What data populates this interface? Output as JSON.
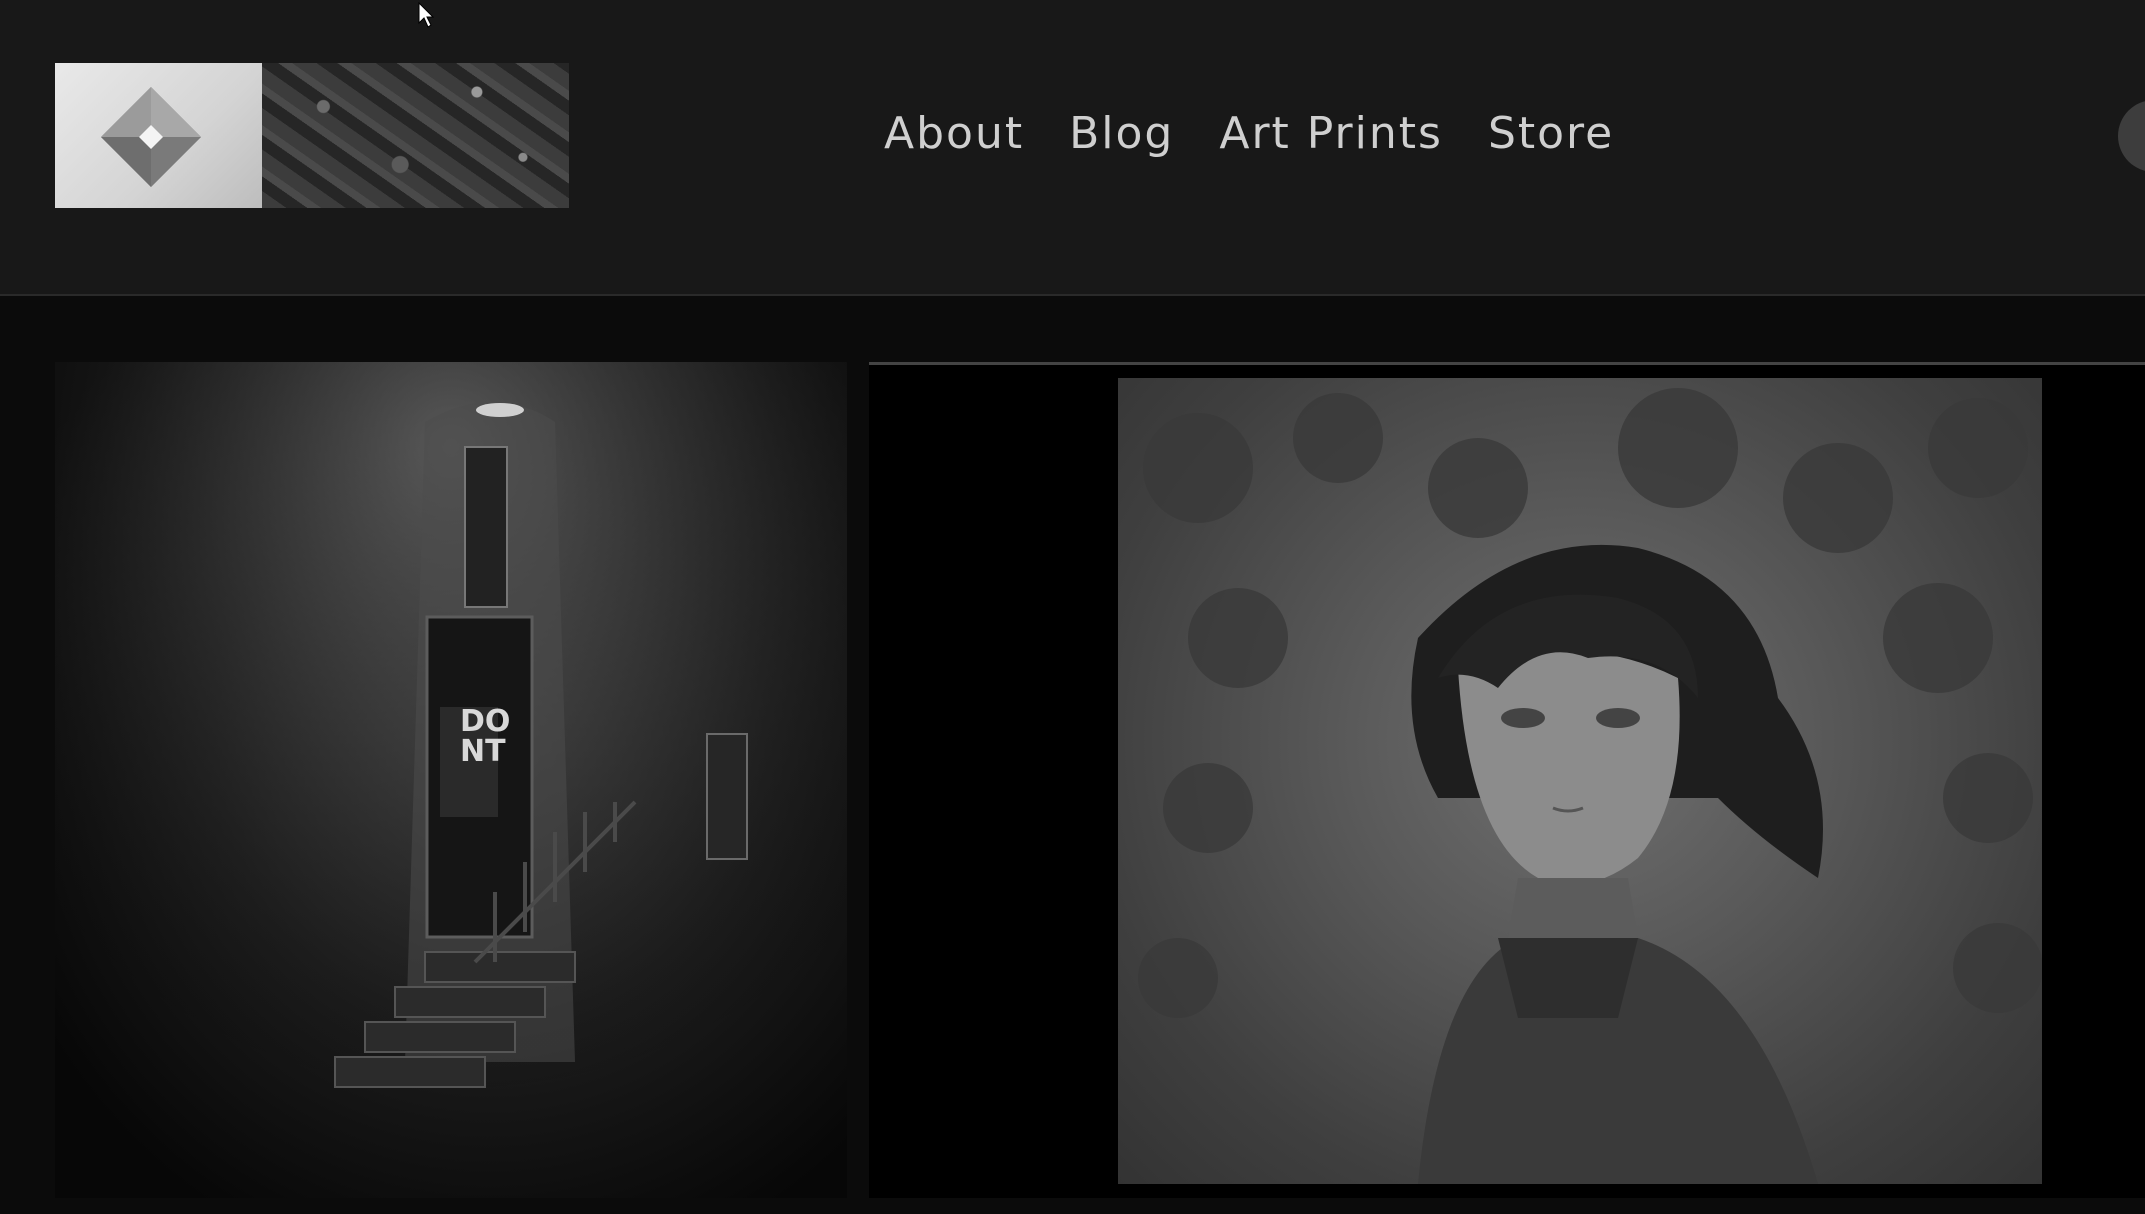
{
  "nav": {
    "items": [
      "About",
      "Blog",
      "Art Prints",
      "Store"
    ]
  },
  "gallery": {
    "left_sign_text": "DO NT",
    "items": [
      {
        "name": "alley-door-artwork"
      },
      {
        "name": "girl-portrait-artwork"
      }
    ]
  },
  "colors": {
    "header_bg": "#181818",
    "page_bg": "#0b0b0b",
    "nav_text": "#cfcfcf"
  },
  "icons": [
    "logo-icon",
    "cursor-icon"
  ]
}
